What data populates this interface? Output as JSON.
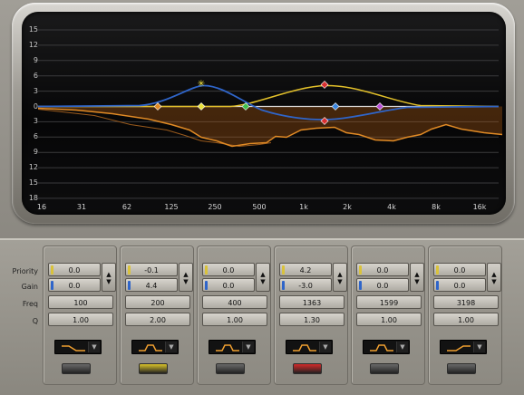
{
  "graph": {
    "y_ticks": [
      "15",
      "12",
      "9",
      "6",
      "3",
      "0",
      "3",
      "6",
      "9",
      "12",
      "15",
      "18"
    ],
    "x_ticks": [
      "16",
      "31",
      "62",
      "125",
      "250",
      "500",
      "1k",
      "2k",
      "4k",
      "8k",
      "16k"
    ],
    "colors": {
      "yellow_curve": "#e2c02a",
      "blue_curve": "#2f65c9",
      "orange_curve": "#e08a25",
      "zero_line": "#dcdcdc"
    },
    "markers": [
      {
        "name": "band-1-handle",
        "color": "#e08a25",
        "shape": "diamond"
      },
      {
        "name": "band-2-handle",
        "color": "#e8e03a",
        "shape": "diamond"
      },
      {
        "name": "band-2-peak-handle",
        "color": "#f2e640",
        "shape": "star"
      },
      {
        "name": "band-3-handle",
        "color": "#3fc04a",
        "shape": "diamond"
      },
      {
        "name": "band-4-handle",
        "color": "#d93030",
        "shape": "diamond"
      },
      {
        "name": "band-5-handle",
        "color": "#3a86e0",
        "shape": "diamond"
      },
      {
        "name": "band-6-handle",
        "color": "#b64ed6",
        "shape": "diamond"
      }
    ]
  },
  "labels": {
    "priority": "Priority",
    "gain": "Gain",
    "freq": "Freq",
    "q": "Q"
  },
  "bands": [
    {
      "priority": "0.0",
      "gain": "0.0",
      "freq": "100",
      "q": "1.00",
      "shape": "low-shelf",
      "led": "#6a6a6a",
      "indicator_priority": "#d9c23a",
      "indicator_gain": "#2f65c9"
    },
    {
      "priority": "-0.1",
      "gain": "4.4",
      "freq": "200",
      "q": "2.00",
      "shape": "bell",
      "led": "#d9c32a",
      "indicator_priority": "#d9c23a",
      "indicator_gain": "#2f65c9"
    },
    {
      "priority": "0.0",
      "gain": "0.0",
      "freq": "400",
      "q": "1.00",
      "shape": "bell",
      "led": "#6a6a6a",
      "indicator_priority": "#d9c23a",
      "indicator_gain": "#2f65c9"
    },
    {
      "priority": "4.2",
      "gain": "-3.0",
      "freq": "1363",
      "q": "1.30",
      "shape": "bell",
      "led": "#d42a2a",
      "indicator_priority": "#d9c23a",
      "indicator_gain": "#2f65c9"
    },
    {
      "priority": "0.0",
      "gain": "0.0",
      "freq": "1599",
      "q": "1.00",
      "shape": "bell",
      "led": "#6a6a6a",
      "indicator_priority": "#d9c23a",
      "indicator_gain": "#2f65c9"
    },
    {
      "priority": "0.0",
      "gain": "0.0",
      "freq": "3198",
      "q": "1.00",
      "shape": "high-shelf",
      "led": "#6a6a6a",
      "indicator_priority": "#d9c23a",
      "indicator_gain": "#2f65c9"
    }
  ]
}
